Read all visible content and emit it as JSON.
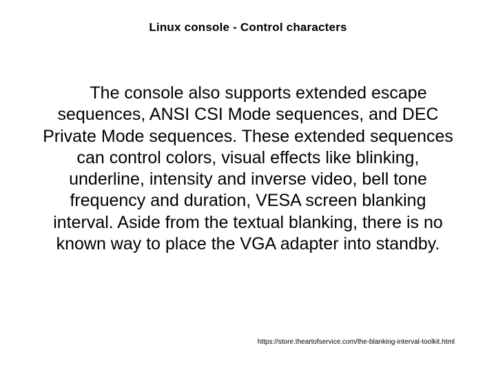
{
  "slide": {
    "title": "Linux console - Control characters",
    "body": "The console also supports extended escape sequences, ANSI CSI Mode sequences, and DEC Private Mode sequences. These extended sequences can control colors, visual effects like blinking, underline, intensity and inverse video, bell tone frequency and duration, VESA screen blanking interval. Aside from the textual blanking, there is no known way to place the VGA adapter into standby.",
    "footer_url": "https://store.theartofservice.com/the-blanking-interval-toolkit.html"
  }
}
